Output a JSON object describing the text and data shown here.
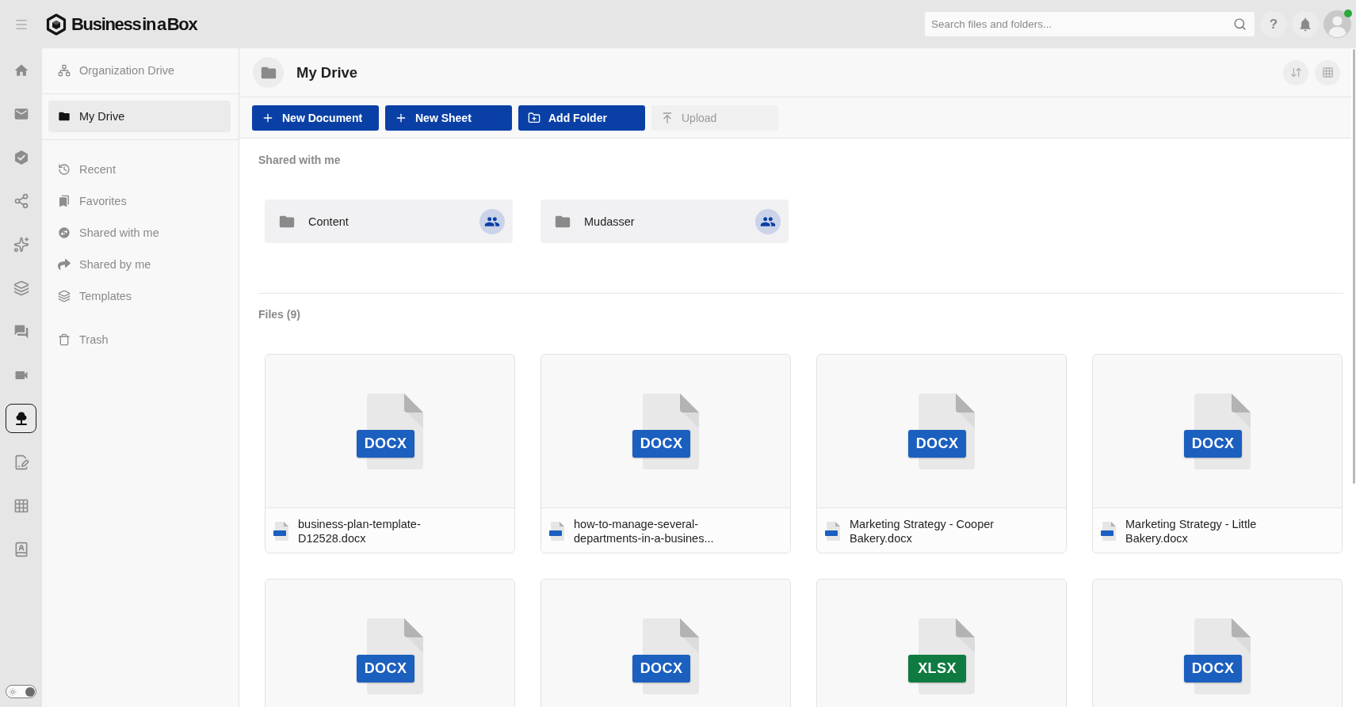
{
  "topbar": {
    "logo": "Business in a Box",
    "search": {
      "placeholder": "Search files and folders..."
    },
    "help": "?",
    "avatar": {
      "online": true
    }
  },
  "rail": {
    "items": [
      {
        "selected": false
      },
      {
        "selected": false
      },
      {
        "selected": false
      },
      {
        "selected": false
      },
      {
        "selected": false
      },
      {
        "selected": false
      },
      {
        "selected": false
      },
      {
        "selected": false
      },
      {
        "selected": true
      },
      {
        "selected": false
      },
      {
        "selected": false
      },
      {
        "selected": false
      }
    ],
    "theme_toggle": {
      "on": true
    }
  },
  "sidebar": {
    "drives": [
      {
        "label": "Organization Drive",
        "selected": false
      },
      {
        "label": "My Drive",
        "selected": true
      }
    ],
    "places": [
      {
        "label": "Recent",
        "selected": false
      },
      {
        "label": "Favorites",
        "selected": false
      },
      {
        "label": "Shared with me",
        "selected": false
      },
      {
        "label": "Shared by me",
        "selected": false
      },
      {
        "label": "Templates",
        "selected": false
      }
    ],
    "trash": [
      {
        "label": "Trash",
        "selected": false
      }
    ]
  },
  "main": {
    "title": "My Drive",
    "toolbar": [
      {
        "label": "New Document",
        "kind": "create",
        "disabled": false
      },
      {
        "label": "New Sheet",
        "kind": "create",
        "disabled": false
      },
      {
        "label": "Add Folder",
        "kind": "folder",
        "disabled": false
      },
      {
        "label": "Upload",
        "kind": "upload",
        "disabled": true
      }
    ],
    "shared": {
      "heading": "Shared with me",
      "folders": [
        {
          "name": "Content"
        },
        {
          "name": "Mudasser"
        }
      ]
    },
    "files": {
      "heading": "Files (9)",
      "items": [
        {
          "name": "business-plan-template-D12528.docx",
          "kind": "docx",
          "badge": "DOCX"
        },
        {
          "name": "how-to-manage-several-departments-in-a-busines...",
          "kind": "docx",
          "badge": "DOCX"
        },
        {
          "name": "Marketing Strategy - Cooper Bakery.docx",
          "kind": "docx",
          "badge": "DOCX"
        },
        {
          "name": "Marketing Strategy - Little Bakery.docx",
          "kind": "docx",
          "badge": "DOCX"
        },
        {
          "kind": "docx",
          "badge": "DOCX"
        },
        {
          "kind": "docx",
          "badge": "DOCX"
        },
        {
          "kind": "xlsx",
          "badge": "XLSX"
        },
        {
          "kind": "docx",
          "badge": "DOCX"
        }
      ]
    }
  }
}
